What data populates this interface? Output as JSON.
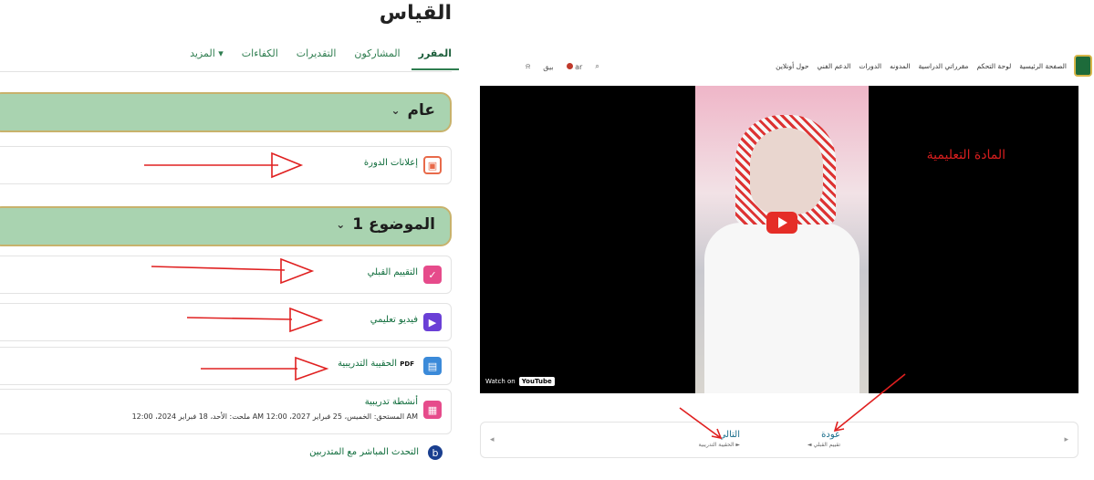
{
  "course": {
    "title": "القياس"
  },
  "tabs": [
    {
      "label": "المقرر"
    },
    {
      "label": "المشاركون"
    },
    {
      "label": "التقديرات"
    },
    {
      "label": "الكفاءات"
    },
    {
      "label": "المزيد ▾"
    }
  ],
  "sections": [
    {
      "title": "عام"
    },
    {
      "title": "الموضوع 1"
    }
  ],
  "items": {
    "announcements": {
      "label": "إعلانات الدورة",
      "icon": "forum-icon"
    },
    "pretest": {
      "label": "التقييم القبلي",
      "icon": "quiz-icon"
    },
    "video": {
      "label": "فيديو تعليمي",
      "icon": "play-icon"
    },
    "bag": {
      "label": "الحقيبة التدريبية",
      "tag": "PDF",
      "icon": "file-icon"
    },
    "activities": {
      "label": "أنشطة تدريبية",
      "sub": "ملحت: الأحد، 18 فبراير 2024، 12:00 AM   المستحق: الخميس، 25 فبراير 2027، 12:00 AM",
      "icon": "assignment-icon"
    },
    "live": {
      "label": "التحدث المباشر مع المتدربين",
      "icon": "chat-icon"
    }
  },
  "site_nav": {
    "links": [
      "الصفحة الرئيسية",
      "لوحة التحكم",
      "مقرراتي الدراسية",
      "المدونه",
      "الدورات",
      "الدعم الفني",
      "حول أونلاين"
    ],
    "lang": "ar",
    "user": "بيق"
  },
  "video": {
    "overlay_text": "المادة التعليمية",
    "watch_on": "Watch on",
    "yt": "YouTube"
  },
  "pager": {
    "back_title": "عودة",
    "back_sub": "◄ تقييم القبلي",
    "next_title": "التالي",
    "next_sub": "الحقيبة التدريبية ►"
  },
  "colors": {
    "accent": "#2e7d4f",
    "section_bg": "#a9d3b0",
    "section_border": "#c8b26c",
    "annotation": "#e02020"
  }
}
